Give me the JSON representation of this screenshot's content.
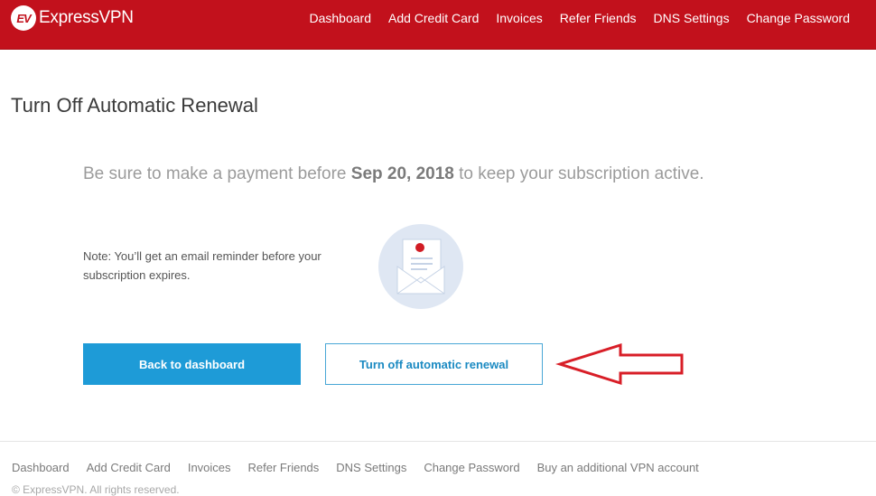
{
  "header": {
    "logo_mark": "EV",
    "logo_text": "ExpressVPN",
    "nav": [
      "Dashboard",
      "Add Credit Card",
      "Invoices",
      "Refer Friends",
      "DNS Settings",
      "Change Password"
    ]
  },
  "main": {
    "title": "Turn Off Automatic Renewal",
    "lead_prefix": "Be sure to make a payment before ",
    "lead_date": "Sep 20, 2018",
    "lead_suffix": " to keep your subscription active.",
    "note": "Note: You’ll get an email reminder before your subscription expires.",
    "illustration_icon": "envelope-icon",
    "back_button": "Back to dashboard",
    "turn_off_button": "Turn off automatic renewal"
  },
  "annotation": {
    "icon": "red-arrow-icon",
    "color": "#d81e27"
  },
  "footer": {
    "nav": [
      "Dashboard",
      "Add Credit Card",
      "Invoices",
      "Refer Friends",
      "DNS Settings",
      "Change Password",
      "Buy an additional VPN account"
    ],
    "copyright": "© ExpressVPN. All rights reserved."
  },
  "colors": {
    "brand_red": "#c2111c",
    "primary_blue": "#1e9bd7",
    "secondary_border": "#49a7d6",
    "lead_text": "#9b9b9b"
  }
}
